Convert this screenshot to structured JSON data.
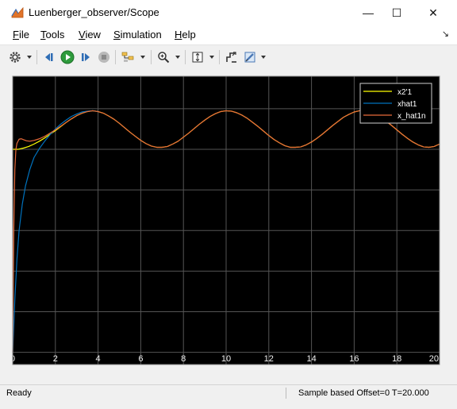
{
  "window": {
    "title": "Luenberger_observer/Scope",
    "minimize_glyph": "—",
    "maximize_glyph": "☐",
    "close_glyph": "✕"
  },
  "menu": {
    "items": [
      "File",
      "Tools",
      "View",
      "Simulation",
      "Help"
    ],
    "overflow_glyph": "↘"
  },
  "toolbar": {
    "icons": [
      "gear-icon",
      "step-back-icon",
      "run-icon",
      "step-forward-icon",
      "stop-icon",
      "signal-highlight-icon",
      "zoom-icon",
      "autoscale-icon",
      "triggers-icon",
      "style-icon"
    ]
  },
  "status": {
    "left": "Ready",
    "right": "Sample based  Offset=0   T=20.000"
  },
  "colors": {
    "plot_background": "#000000",
    "grid": "#555555",
    "series_yellow": "#ffff00",
    "series_blue": "#0072bd",
    "series_orange": "#e86a3a"
  },
  "chart_data": {
    "type": "line",
    "title": "",
    "xlabel": "",
    "ylabel": "",
    "xlim": [
      0,
      20
    ],
    "ylim": [
      -0.3,
      6.8
    ],
    "xticks": [
      0,
      2,
      4,
      6,
      8,
      10,
      12,
      14,
      16,
      18,
      20
    ],
    "yticks": [
      0,
      1,
      2,
      3,
      4,
      5,
      6
    ],
    "grid": true,
    "legend_position": "top-right",
    "series": [
      {
        "name": "x2'1",
        "color": "#ffff00",
        "x": [
          0,
          0.25,
          0.5,
          0.75,
          1.0,
          1.25,
          1.5,
          1.75,
          2.0,
          2.25,
          2.5,
          2.75,
          3.0,
          3.25,
          3.5,
          3.75,
          4.0,
          4.25,
          4.5,
          4.75,
          5.0,
          5.25,
          5.5,
          5.75,
          6.0,
          6.25,
          6.5,
          6.75,
          7.0,
          7.25,
          7.5,
          7.75,
          8.0,
          8.25,
          8.5,
          8.75,
          9.0,
          9.25,
          9.5,
          9.75,
          10.0,
          10.25,
          10.5,
          10.75,
          11.0,
          11.25,
          11.5,
          11.75,
          12.0,
          12.25,
          12.5,
          12.75,
          13.0,
          13.25,
          13.5,
          13.75,
          14.0,
          14.25,
          14.5,
          14.75,
          15.0,
          15.25,
          15.5,
          15.75,
          16.0,
          16.25,
          16.5,
          16.75,
          17.0,
          17.25,
          17.5,
          17.75,
          18.0,
          18.25,
          18.5,
          18.75,
          19.0,
          19.25,
          19.5,
          19.75,
          20.0
        ],
        "y": [
          5.0,
          5.0,
          5.03,
          5.07,
          5.13,
          5.2,
          5.28,
          5.37,
          5.46,
          5.56,
          5.66,
          5.75,
          5.83,
          5.89,
          5.93,
          5.95,
          5.93,
          5.89,
          5.82,
          5.74,
          5.64,
          5.53,
          5.42,
          5.32,
          5.22,
          5.14,
          5.08,
          5.05,
          5.05,
          5.07,
          5.13,
          5.2,
          5.3,
          5.4,
          5.51,
          5.62,
          5.72,
          5.81,
          5.88,
          5.93,
          5.95,
          5.94,
          5.9,
          5.84,
          5.76,
          5.66,
          5.56,
          5.45,
          5.34,
          5.24,
          5.16,
          5.09,
          5.05,
          5.05,
          5.06,
          5.11,
          5.18,
          5.27,
          5.37,
          5.48,
          5.59,
          5.69,
          5.79,
          5.86,
          5.92,
          5.95,
          5.95,
          5.92,
          5.86,
          5.78,
          5.69,
          5.59,
          5.48,
          5.37,
          5.27,
          5.18,
          5.11,
          5.06,
          5.05,
          5.07,
          5.13
        ]
      },
      {
        "name": "xhat1",
        "color": "#0072bd",
        "x": [
          0,
          0.1,
          0.2,
          0.3,
          0.45,
          0.6,
          0.8,
          1.0,
          1.25,
          1.5,
          1.75,
          2.0,
          2.25,
          2.5,
          2.75,
          3.0,
          3.25,
          3.5,
          3.75,
          4.0
        ],
        "y": [
          0.0,
          1.3,
          2.3,
          3.0,
          3.65,
          4.1,
          4.5,
          4.8,
          5.02,
          5.2,
          5.36,
          5.5,
          5.62,
          5.72,
          5.81,
          5.87,
          5.92,
          5.94,
          5.95,
          5.93
        ]
      },
      {
        "name": "x_hat1n",
        "color": "#e86a3a",
        "x": [
          0,
          0.05,
          0.1,
          0.15,
          0.2,
          0.3,
          0.4,
          0.5,
          0.65,
          0.8,
          1.0,
          1.25,
          1.5,
          1.75,
          2.0,
          2.25,
          2.5,
          2.75,
          3.0,
          3.25,
          3.5,
          3.75,
          4.0,
          4.25,
          4.5,
          4.75,
          5.0,
          5.25,
          5.5,
          5.75,
          6.0,
          6.25,
          6.5,
          6.75,
          7.0,
          7.25,
          7.5,
          7.75,
          8.0,
          8.25,
          8.5,
          8.75,
          9.0,
          9.25,
          9.5,
          9.75,
          10.0,
          10.25,
          10.5,
          10.75,
          11.0,
          11.25,
          11.5,
          11.75,
          12.0,
          12.25,
          12.5,
          12.75,
          13.0,
          13.25,
          13.5,
          13.75,
          14.0,
          14.25,
          14.5,
          14.75,
          15.0,
          15.25,
          15.5,
          15.75,
          16.0,
          16.25,
          16.5,
          16.75,
          17.0,
          17.25,
          17.5,
          17.75,
          18.0,
          18.25,
          18.5,
          18.75,
          19.0,
          19.25,
          19.5,
          19.75,
          20.0
        ],
        "y": [
          0.0,
          3.0,
          4.5,
          5.0,
          5.15,
          5.25,
          5.26,
          5.24,
          5.21,
          5.2,
          5.22,
          5.26,
          5.32,
          5.4,
          5.48,
          5.57,
          5.66,
          5.75,
          5.83,
          5.89,
          5.93,
          5.95,
          5.93,
          5.89,
          5.82,
          5.74,
          5.64,
          5.53,
          5.42,
          5.32,
          5.22,
          5.14,
          5.08,
          5.05,
          5.05,
          5.07,
          5.13,
          5.2,
          5.3,
          5.4,
          5.51,
          5.62,
          5.72,
          5.81,
          5.88,
          5.93,
          5.95,
          5.94,
          5.9,
          5.84,
          5.76,
          5.66,
          5.56,
          5.45,
          5.34,
          5.24,
          5.16,
          5.09,
          5.05,
          5.05,
          5.06,
          5.11,
          5.18,
          5.27,
          5.37,
          5.48,
          5.59,
          5.69,
          5.79,
          5.86,
          5.92,
          5.95,
          5.95,
          5.92,
          5.86,
          5.78,
          5.69,
          5.59,
          5.48,
          5.37,
          5.27,
          5.18,
          5.11,
          5.06,
          5.05,
          5.07,
          5.13
        ]
      }
    ]
  }
}
